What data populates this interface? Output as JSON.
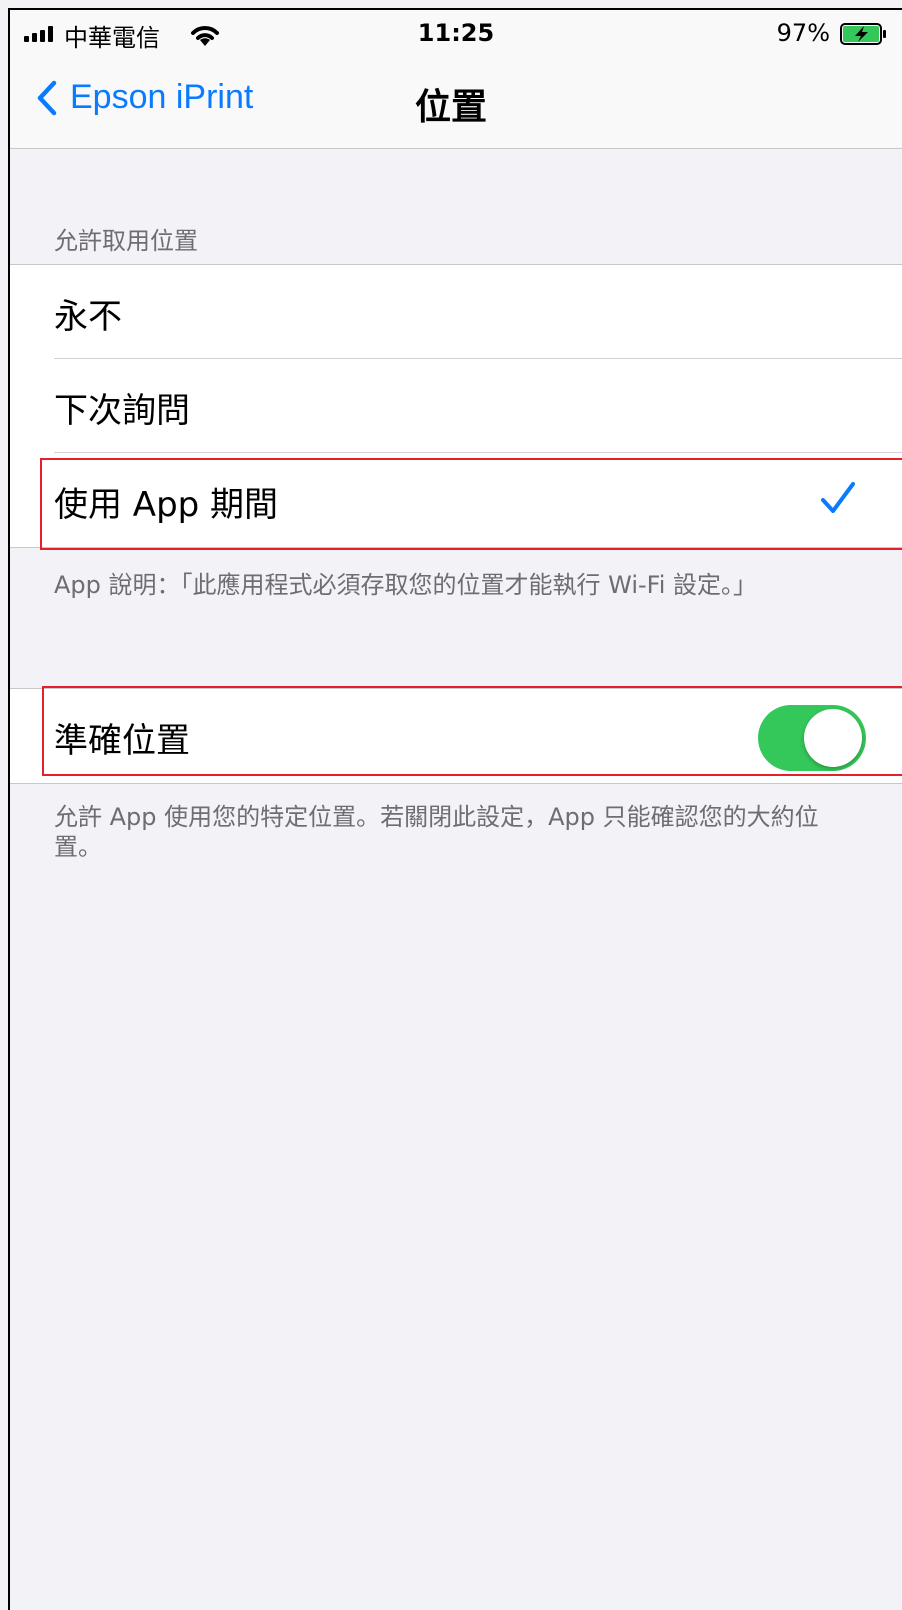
{
  "status_bar": {
    "carrier": "中華電信",
    "time": "11:25",
    "battery": "97%"
  },
  "nav": {
    "back_label": "Epson iPrint",
    "title": "位置"
  },
  "location_access": {
    "header": "允許取用位置",
    "options": [
      {
        "label": "永不",
        "selected": false
      },
      {
        "label": "下次詢問",
        "selected": false
      },
      {
        "label": "使用 App 期間",
        "selected": true
      }
    ],
    "footer": "App 說明：「此應用程式必須存取您的位置才能執行 Wi-Fi 設定。」"
  },
  "precise_location": {
    "label": "準確位置",
    "enabled": true,
    "footer": "允許 App 使用您的特定位置。若關閉此設定，App 只能確認您的大約位置。"
  },
  "colors": {
    "accent": "#0a7aff",
    "toggle_on": "#34c759",
    "highlight": "#e3202b",
    "background": "#f2f2f7"
  },
  "icons": [
    "signal-icon",
    "wifi-icon",
    "battery-charging-icon",
    "chevron-left-icon",
    "checkmark-icon"
  ]
}
